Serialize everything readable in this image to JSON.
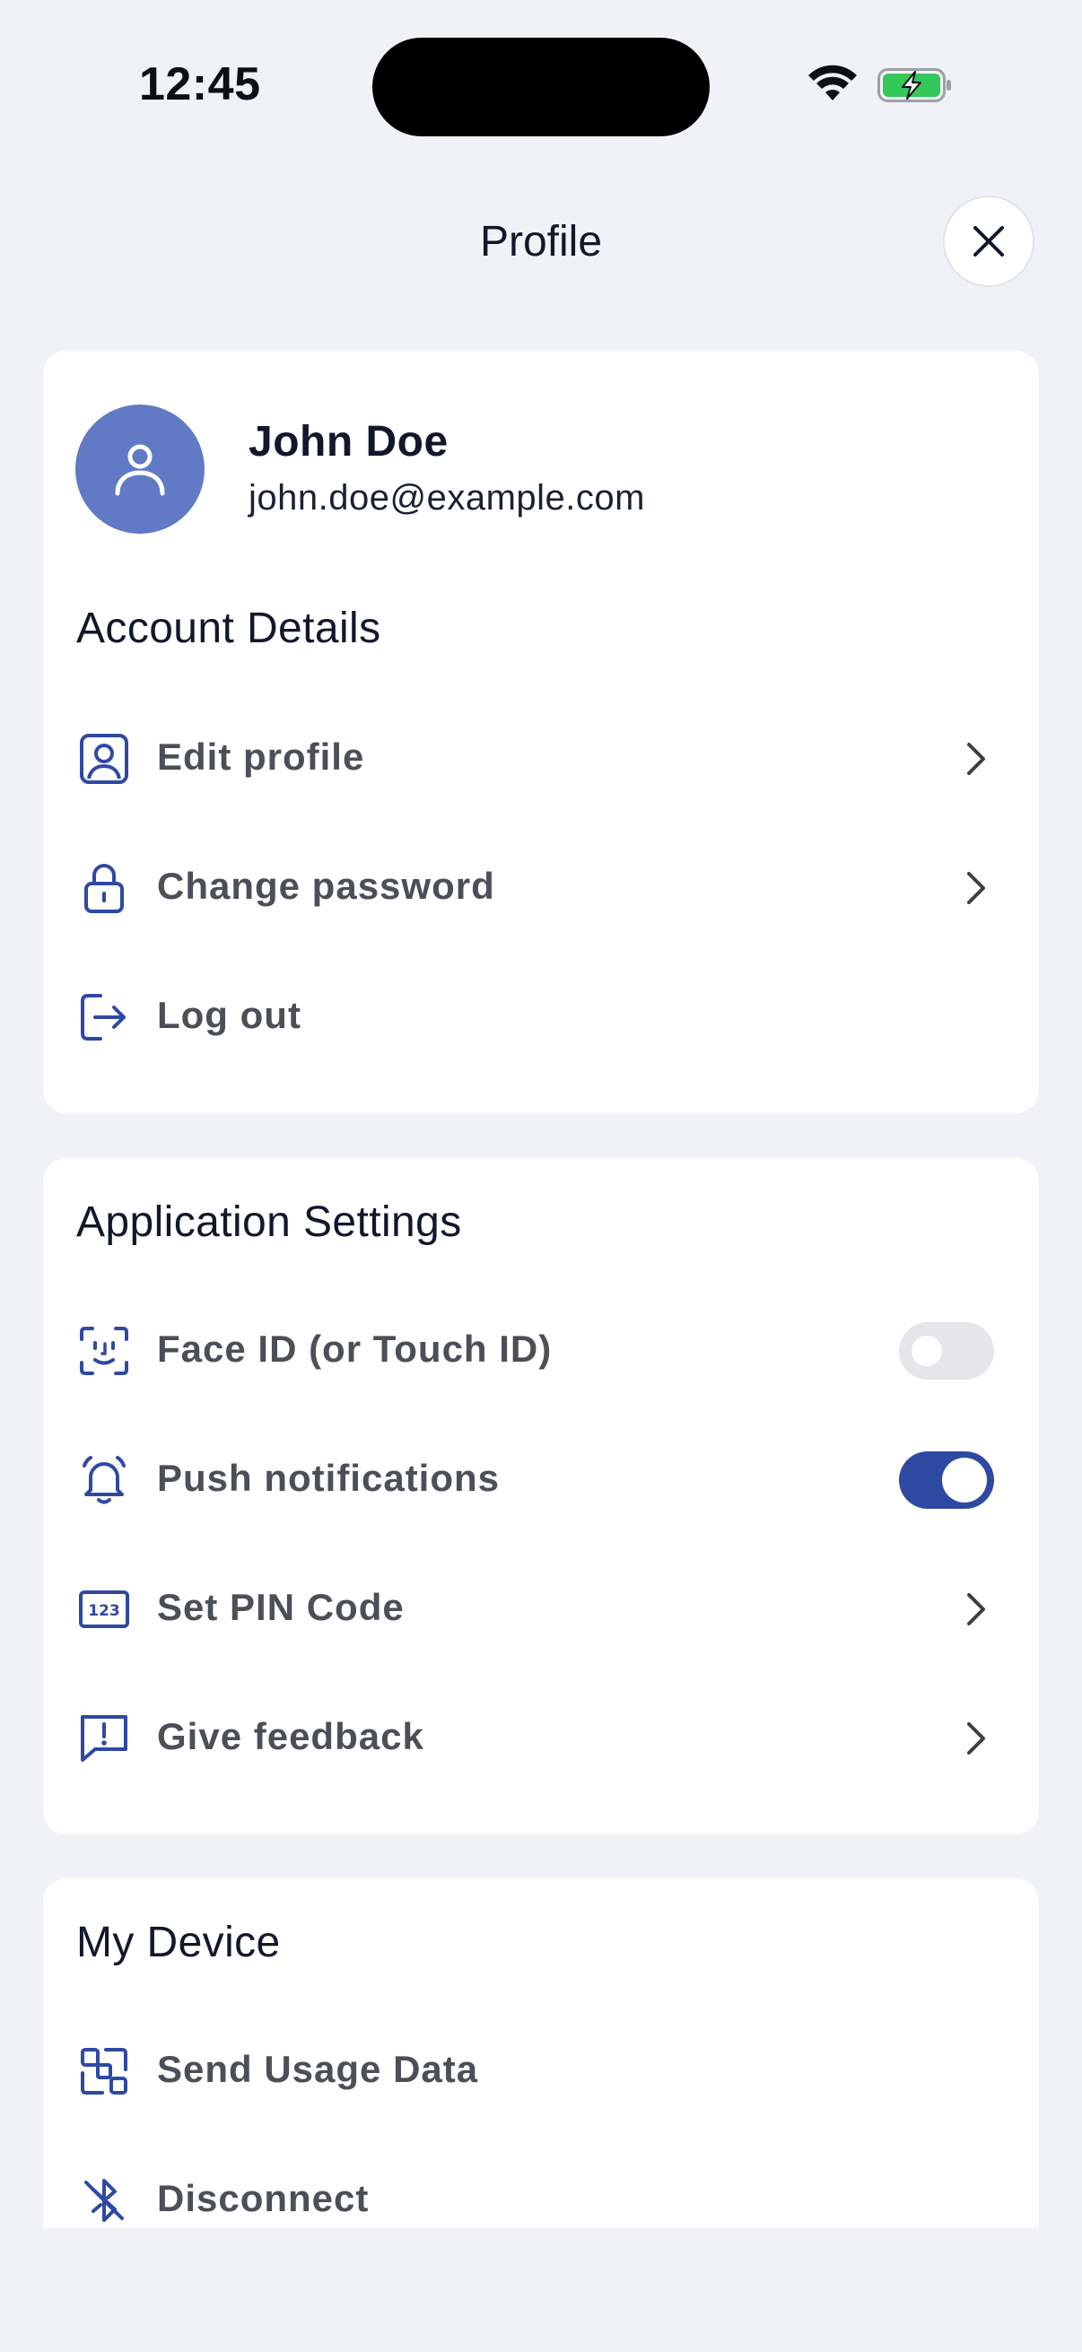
{
  "status_bar": {
    "time": "12:45"
  },
  "header": {
    "title": "Profile"
  },
  "profile": {
    "name": "John Doe",
    "email": "john.doe@example.com"
  },
  "account_details": {
    "title": "Account Details",
    "items": [
      {
        "label": "Edit profile",
        "icon": "user-square-icon"
      },
      {
        "label": "Change password",
        "icon": "lock-icon"
      },
      {
        "label": "Log out",
        "icon": "logout-icon"
      }
    ]
  },
  "app_settings": {
    "title": "Application Settings",
    "items": [
      {
        "label": "Face ID (or Touch ID)",
        "icon": "face-id-icon",
        "toggle": false
      },
      {
        "label": "Push notifications",
        "icon": "bell-icon",
        "toggle": true
      },
      {
        "label": "Set PIN Code",
        "icon": "pin-code-icon",
        "pin_text": "123"
      },
      {
        "label": "Give feedback",
        "icon": "feedback-icon"
      }
    ]
  },
  "my_device": {
    "title": "My Device",
    "items": [
      {
        "label": "Send Usage Data",
        "icon": "scan-data-icon"
      },
      {
        "label": "Disconnect",
        "icon": "bluetooth-off-icon"
      }
    ]
  },
  "colors": {
    "background": "#F1F2F6",
    "card": "#FFFFFF",
    "accent": "#2F49A3",
    "avatar": "#6279C6",
    "label": "#4C4E58",
    "battery_green": "#34C759"
  }
}
